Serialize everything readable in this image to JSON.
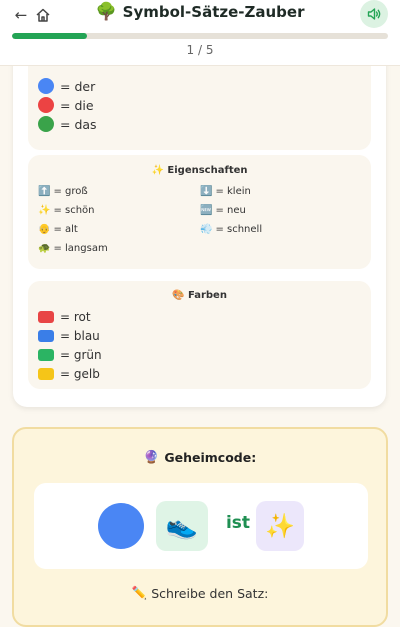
{
  "header": {
    "title": "Symbol-Sätze-Zauber",
    "title_icon": "🌳",
    "back_icon": "←",
    "progress_text": "1 / 5",
    "progress_fraction": 0.2,
    "accent": "#23a455"
  },
  "legend": {
    "articles": [
      {
        "color": "#4a86f4",
        "label": "= der"
      },
      {
        "color": "#ec4343",
        "label": "= die"
      },
      {
        "color": "#3aa34a",
        "label": "= das"
      }
    ],
    "properties": {
      "title_icon": "✨",
      "title": "Eigenschaften",
      "items": [
        {
          "icon": "⬆️",
          "label": "= groß"
        },
        {
          "icon": "⬇️",
          "label": "= klein"
        },
        {
          "icon": "✨",
          "label": "= schön"
        },
        {
          "icon": "🆕",
          "label": "= neu"
        },
        {
          "icon": "👴",
          "label": "= alt"
        },
        {
          "icon": "💨",
          "label": "= schnell"
        },
        {
          "icon": "🐢",
          "label": "= langsam"
        }
      ]
    },
    "colors": {
      "title_icon": "🎨",
      "title": "Farben",
      "items": [
        {
          "color": "#e84545",
          "label": "= rot"
        },
        {
          "color": "#3a7ee8",
          "label": "= blau"
        },
        {
          "color": "#2bb463",
          "label": "= grün"
        },
        {
          "color": "#f5c518",
          "label": "= gelb"
        }
      ]
    }
  },
  "code": {
    "title_icon": "🔮",
    "title": "Geheimcode:",
    "circle_color": "#4a86f4",
    "shoe_icon": "👟",
    "word": "ist",
    "sparkle_icon": "✨",
    "write_icon": "✏️",
    "write_label": "Schreibe den Satz:"
  }
}
